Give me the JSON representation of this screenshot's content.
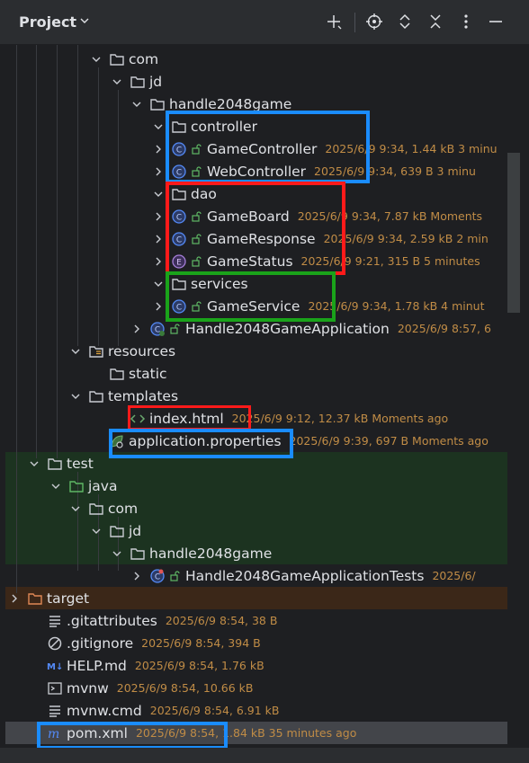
{
  "header": {
    "title": "Project",
    "icons": [
      "chevron-down-icon",
      "add-icon",
      "locate-icon",
      "expand-all-icon",
      "collapse-all-icon",
      "more-icon",
      "minimize-icon"
    ]
  },
  "colors": {
    "folder": "#c9ccd2",
    "class": "#548af7",
    "enum": "#a57ed8",
    "meta": "#c08c46",
    "highlight_blue": "#1a8cff",
    "highlight_red": "#ff1a1a",
    "highlight_green": "#1aa31a"
  },
  "tree": {
    "com": {
      "name": "com"
    },
    "jd": {
      "name": "jd"
    },
    "handle2048game": {
      "name": "handle2048game"
    },
    "controller": {
      "name": "controller"
    },
    "game_controller": {
      "name": "GameController",
      "meta": "2025/6/9 9:34, 1.44 kB 3 minu"
    },
    "web_controller": {
      "name": "WebController",
      "meta": "2025/6/9 9:34, 639 B 3 minu"
    },
    "dao": {
      "name": "dao"
    },
    "game_board": {
      "name": "GameBoard",
      "meta": "2025/6/9 9:34, 7.87 kB Moments"
    },
    "game_response": {
      "name": "GameResponse",
      "meta": "2025/6/9 9:34, 2.59 kB 2 min"
    },
    "game_status": {
      "name": "GameStatus",
      "meta": "2025/6/9 9:21, 315 B 5 minutes"
    },
    "services": {
      "name": "services"
    },
    "game_service": {
      "name": "GameService",
      "meta": "2025/6/9 9:34, 1.78 kB 4 minut"
    },
    "app_class": {
      "name": "Handle2048GameApplication",
      "meta": "2025/6/9 8:57, 6"
    },
    "resources": {
      "name": "resources"
    },
    "static": {
      "name": "static"
    },
    "templates": {
      "name": "templates"
    },
    "index_html": {
      "name": "index.html",
      "meta": "2025/6/9 9:12, 12.37 kB Moments ago"
    },
    "app_props": {
      "name": "application.properties",
      "meta": "2025/6/9 9:39, 697 B Moments ago"
    },
    "test": {
      "name": "test"
    },
    "java": {
      "name": "java"
    },
    "test_com": {
      "name": "com"
    },
    "test_jd": {
      "name": "jd"
    },
    "test_handle": {
      "name": "handle2048game"
    },
    "app_tests": {
      "name": "Handle2048GameApplicationTests",
      "meta": "2025/6/"
    },
    "target": {
      "name": "target"
    },
    "gitattributes": {
      "name": ".gitattributes",
      "meta": "2025/6/9 8:54, 38 B"
    },
    "gitignore": {
      "name": ".gitignore",
      "meta": "2025/6/9 8:54, 394 B"
    },
    "help_md": {
      "name": "HELP.md",
      "meta": "2025/6/9 8:54, 1.76 kB"
    },
    "mvnw": {
      "name": "mvnw",
      "meta": "2025/6/9 8:54, 10.66 kB"
    },
    "mvnw_cmd": {
      "name": "mvnw.cmd",
      "meta": "2025/6/9 8:54, 6.91 kB"
    },
    "pom_xml": {
      "name": "pom.xml",
      "meta": "2025/6/9 8:54, 1.84 kB 35 minutes ago"
    }
  }
}
